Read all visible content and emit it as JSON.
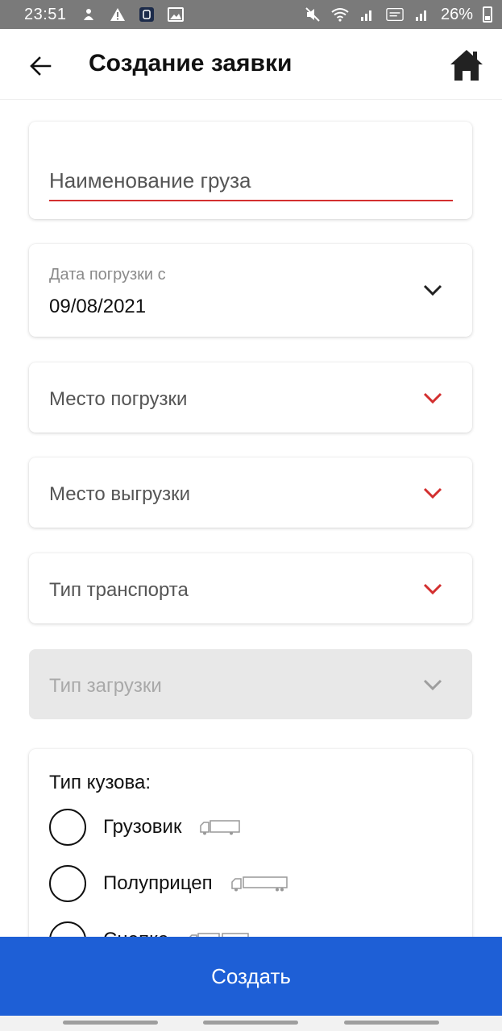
{
  "status_bar": {
    "time": "23:51",
    "battery": "26%",
    "icons": [
      "mute-icon",
      "wifi-icon",
      "signal-icon",
      "volte-icon",
      "signal-icon",
      "battery-icon"
    ]
  },
  "app_bar": {
    "title": "Создание заявки"
  },
  "form": {
    "cargo_name_placeholder": "Наименование груза",
    "loading_date_label": "Дата погрузки с",
    "loading_date_value": "09/08/2021",
    "loading_place_label": "Место погрузки",
    "unloading_place_label": "Место выгрузки",
    "transport_type_label": "Тип транспорта",
    "loading_type_label": "Тип загрузки",
    "body_type": {
      "label": "Тип кузова:",
      "options": [
        "Грузовик",
        "Полуприцеп",
        "Сцепка"
      ]
    }
  },
  "actions": {
    "create_label": "Создать"
  },
  "colors": {
    "accent": "#1e5fd6",
    "error": "#d32f2f",
    "status_bar": "#7a7a7a"
  }
}
